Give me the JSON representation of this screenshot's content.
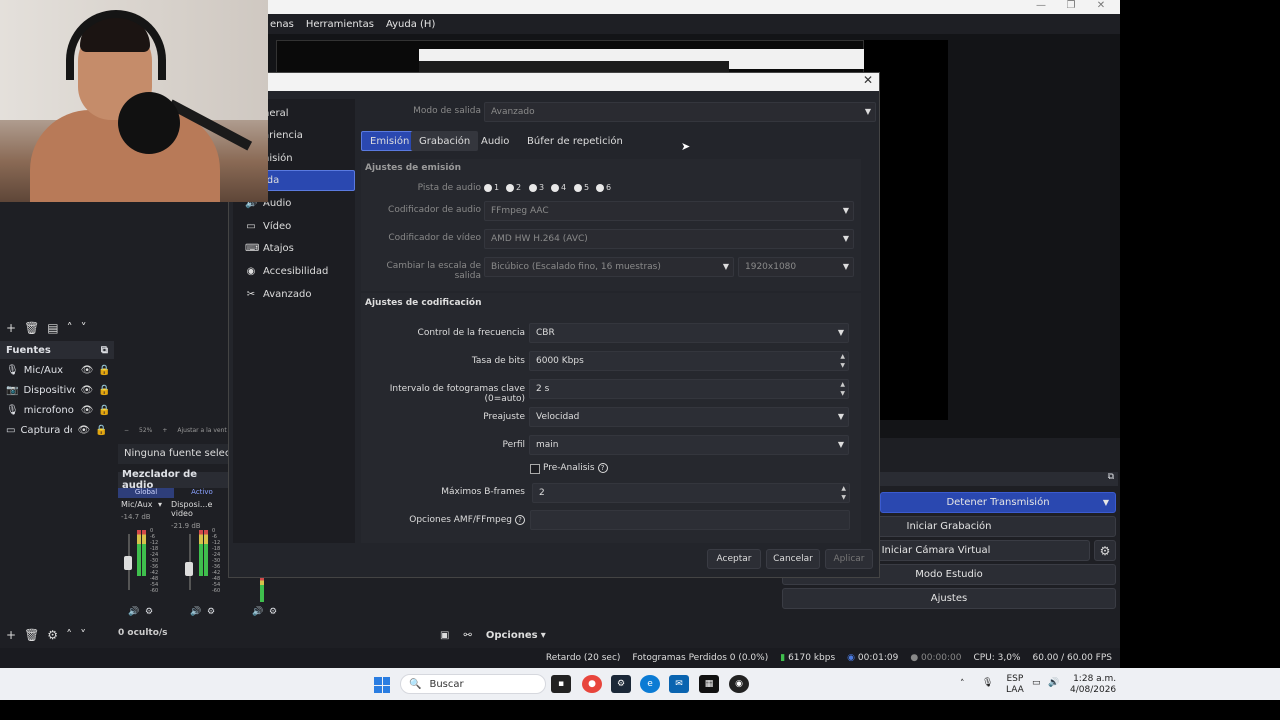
{
  "app": {
    "menu": [
      "enas",
      "Herramientas",
      "Ayuda (H)"
    ],
    "window_controls": [
      "—",
      "❐",
      "✕"
    ]
  },
  "left_panel": {
    "sources_title": "Fuentes",
    "sources": [
      {
        "label": "Mic/Aux",
        "icon": "mic-icon"
      },
      {
        "label": "Dispositivo d",
        "icon": "camera-icon"
      },
      {
        "label": "microfono",
        "icon": "mic-icon"
      },
      {
        "label": "Captura de p",
        "icon": "monitor-icon"
      }
    ],
    "zoom_text": "52%",
    "fit_text": "Ajustar a la vent",
    "no_source_text": "Ninguna fuente selecciona",
    "mixer_title": "Mezclador de audio",
    "mixer_tabs": [
      "Global",
      "Activo"
    ],
    "channels": [
      {
        "name": "Mic/Aux",
        "db": "-14.7 dB"
      },
      {
        "name": "Disposi...e video",
        "db": "-21.9 dB"
      }
    ],
    "meter_scale": [
      "0",
      "-6",
      "-12",
      "-18",
      "-24",
      "-30",
      "-36",
      "-42",
      "-48",
      "-54",
      "-60"
    ],
    "hidden_count": "0 oculto/s",
    "options_label": "Opciones"
  },
  "controls": {
    "stop_stream": "Detener Transmisión",
    "start_recording": "Iniciar Grabación",
    "start_virtualcam": "Iniciar Cámara Virtual",
    "studio_mode": "Modo Estudio",
    "settings": "Ajustes"
  },
  "status": {
    "delay": "Retardo (20 sec)",
    "dropped": "Fotogramas Perdidos 0 (0.0%)",
    "bitrate": "6170 kbps",
    "stream_time": "00:01:09",
    "rec_time": "00:00:00",
    "cpu": "CPU: 3,0%",
    "fps": "60.00 / 60.00 FPS"
  },
  "dialog": {
    "close": "✕",
    "nav": [
      {
        "label": "neral",
        "icon": "gear-icon"
      },
      {
        "label": "ariencia",
        "icon": "brush-icon"
      },
      {
        "label": "nisión",
        "icon": "broadcast-icon"
      },
      {
        "label": "ida",
        "icon": "output-icon"
      },
      {
        "label": "Audio",
        "icon": "speaker-icon"
      },
      {
        "label": "Vídeo",
        "icon": "monitor-icon"
      },
      {
        "label": "Atajos",
        "icon": "keyboard-icon"
      },
      {
        "label": "Accesibilidad",
        "icon": "accessibility-icon"
      },
      {
        "label": "Avanzado",
        "icon": "tools-icon"
      }
    ],
    "output_mode_label": "Modo de salida",
    "output_mode_value": "Avanzado",
    "tabs": [
      "Emisión",
      "Grabación",
      "Audio",
      "Búfer de repetición"
    ],
    "stream_section": "Ajustes de emisión",
    "audio_track_label": "Pista de audio",
    "audio_tracks": [
      "1",
      "2",
      "3",
      "4",
      "5",
      "6"
    ],
    "audio_encoder_label": "Codificador de audio",
    "audio_encoder_value": "FFmpeg AAC",
    "video_encoder_label": "Codificador de vídeo",
    "video_encoder_value": "AMD HW H.264 (AVC)",
    "rescale_label": "Cambiar la escala de salida",
    "rescale_filter": "Bicúbico (Escalado fino, 16 muestras)",
    "rescale_res": "1920x1080",
    "encoder_section": "Ajustes de codificación",
    "rate_control_label": "Control de la frecuencia",
    "rate_control_value": "CBR",
    "bitrate_label": "Tasa de bits",
    "bitrate_value": "6000 Kbps",
    "keyframe_label": "Intervalo de fotogramas clave (0=auto)",
    "keyframe_value": "2 s",
    "preset_label": "Preajuste",
    "preset_value": "Velocidad",
    "profile_label": "Perfil",
    "profile_value": "main",
    "preanalysis_label": "Pre-Analisis",
    "bframes_label": "Máximos B-frames",
    "bframes_value": "2",
    "amf_label": "Opciones AMF/FFmpeg",
    "amf_value": "",
    "accept": "Aceptar",
    "cancel": "Cancelar",
    "apply": "Aplicar"
  },
  "taskbar": {
    "search_placeholder": "Buscar",
    "lang1": "ESP",
    "lang2": "LAA",
    "time": "1:28 a.m.",
    "date": "4/08/2026"
  },
  "colors": {
    "accent_blue": "#2a48b0",
    "panel_bg": "#1e1f24",
    "dialog_bg": "#23252b"
  }
}
